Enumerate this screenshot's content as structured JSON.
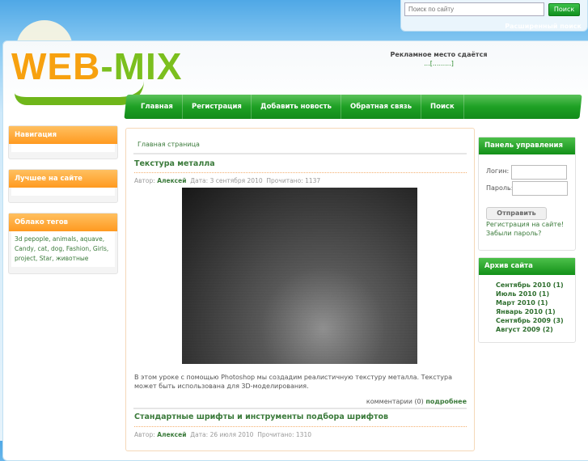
{
  "search": {
    "placeholder": "Поиск по сайту",
    "button": "Поиск",
    "advanced": "Расширенный поиск"
  },
  "logo": {
    "part1": "WEB",
    "part2": "-MIX"
  },
  "ad": {
    "text": "Рекламное место сдаётся",
    "link": "...[.........]"
  },
  "nav": [
    "Главная",
    "Регистрация",
    "Добавить новость",
    "Обратная связь",
    "Поиск"
  ],
  "left": {
    "navigation": "Навигация",
    "best": "Лучшее на сайте",
    "tags_title": "Облако тегов",
    "tags": "3d pepople, animals, aquave, Candy, cat, dog, Fashion, Girls, project, Star, животные"
  },
  "breadcrumb": "Главная страница",
  "posts": [
    {
      "title": "Текстура металла",
      "author_label": "Автор:",
      "author": "Алексей",
      "date": "Дата: 3 сентября 2010",
      "reads": "Прочитано: 1137",
      "text": "В этом уроке с помощью Photoshop мы создадим реалистичную текстуру металла. Текстура может быть использована для 3D-моделирования.",
      "comments": "комментарии (0)",
      "more": "подробнее"
    },
    {
      "title": "Стандартные шрифты и инструменты подбора шрифтов",
      "author_label": "Автор:",
      "author": "Алексей",
      "date": "Дата: 26 июля 2010",
      "reads": "Прочитано: 1310"
    }
  ],
  "panel": {
    "title": "Панель управления",
    "login": "Логин:",
    "password": "Пароль:",
    "submit": "Отправить",
    "register": "Регистрация на сайте!",
    "forgot": "Забыли пароль?"
  },
  "archive": {
    "title": "Архив сайта",
    "items": [
      "Сентябрь 2010 (1)",
      "Июль 2010 (1)",
      "Март 2010 (1)",
      "Январь 2010 (1)",
      "Сентябрь 2009 (3)",
      "Август 2009 (2)"
    ]
  }
}
